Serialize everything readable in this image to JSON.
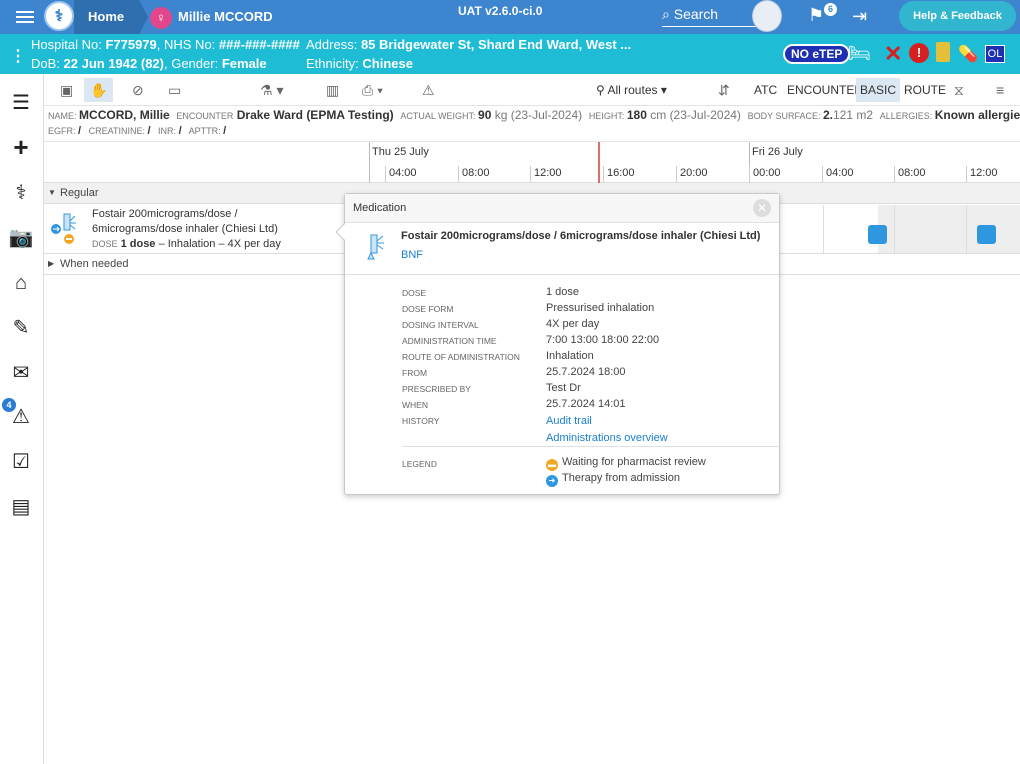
{
  "topbar": {
    "home": "Home",
    "patient_name": "Millie MCCORD",
    "version": "UAT v2.6.0-ci.0",
    "search": "Search",
    "flag_count": "6",
    "help": "Help & Feedback"
  },
  "patient_banner": {
    "hospital_no_label": "Hospital No:",
    "hospital_no": "F775979",
    "nhs_no_label": "NHS No:",
    "nhs_no": "###-###-####",
    "dob_label": "DoB:",
    "dob": "22 Jun 1942 (82)",
    "gender_label": "Gender:",
    "gender": "Female",
    "address_label": "Address:",
    "address": "85 Bridgewater St, Shard End Ward, West ...",
    "ethnicity_label": "Ethnicity:",
    "ethnicity": "Chinese",
    "no_etep": "NO eTEP",
    "ol": "OL"
  },
  "sidebar": {
    "badge": "4"
  },
  "toolbar": {
    "routes": "All routes",
    "atc": "ATC",
    "encounter": "ENCOUNTER",
    "basic": "BASIC",
    "route": "ROUTE"
  },
  "patient_info": {
    "name_label": "NAME",
    "name": "MCCORD, Millie",
    "encounter_label": "ENCOUNTER",
    "encounter": "Drake Ward (EPMA Testing)",
    "weight_label": "ACTUAL WEIGHT",
    "weight_value": "90",
    "weight_unit": "kg",
    "weight_date": "(23-Jul-2024)",
    "height_label": "HEIGHT",
    "height_value": "180",
    "height_unit": "cm",
    "height_date": "(23-Jul-2024)",
    "bsa_label": "BODY SURFACE",
    "bsa_value": "2.",
    "bsa_value2": "121",
    "bsa_unit": "m2",
    "allergies_label": "ALLERGIES",
    "allergies": "Known allergies",
    "egfr_label": "EGFR",
    "egfr": "/",
    "creat_label": "CREATININE",
    "creat": "/",
    "inr_label": "INR",
    "inr": "/",
    "aptt_label": "APTTR",
    "aptt": "/"
  },
  "timeline": {
    "day1": "Thu 25 July",
    "day2": "Fri 26 July",
    "hours": [
      "04:00",
      "08:00",
      "12:00",
      "16:00",
      "20:00",
      "00:00",
      "04:00",
      "08:00",
      "12:00"
    ]
  },
  "groups": {
    "regular": "Regular",
    "when_needed": "When needed"
  },
  "medication": {
    "name_line1": "Fostair 200micrograms/dose /",
    "name_line2": "6micrograms/dose inhaler (Chiesi Ltd)",
    "dose_label": "DOSE",
    "dose": "1 dose",
    "sep": "–",
    "route_freq": "Inhalation – 4X per day"
  },
  "popup": {
    "header": "Medication",
    "title": "Fostair 200micrograms/dose / 6micrograms/dose inhaler (Chiesi Ltd)",
    "bnf": "BNF",
    "rows": [
      {
        "label": "DOSE",
        "value": "1 dose"
      },
      {
        "label": "DOSE FORM",
        "value": "Pressurised inhalation"
      },
      {
        "label": "DOSING INTERVAL",
        "value": "4X per day"
      },
      {
        "label": "ADMINISTRATION TIME",
        "value": "7:00 13:00 18:00 22:00"
      },
      {
        "label": "ROUTE OF ADMINISTRATION",
        "value": "Inhalation"
      },
      {
        "label": "FROM",
        "value": "25.7.2024 18:00"
      },
      {
        "label": "PRESCRIBED BY",
        "value": "Test Dr"
      },
      {
        "label": "WHEN",
        "value": "25.7.2024 14:01"
      },
      {
        "label": "HISTORY",
        "value": "Audit trail"
      }
    ],
    "admin_overview": "Administrations overview",
    "legend_label": "LEGEND",
    "legend1": "Waiting for pharmacist review",
    "legend2": "Therapy from admission"
  },
  "colors": {
    "topbar": "#3d86cf",
    "patient_banner": "#1fbcd5",
    "dose_marker": "#2f97e0",
    "now_line": "#e06b6b"
  }
}
